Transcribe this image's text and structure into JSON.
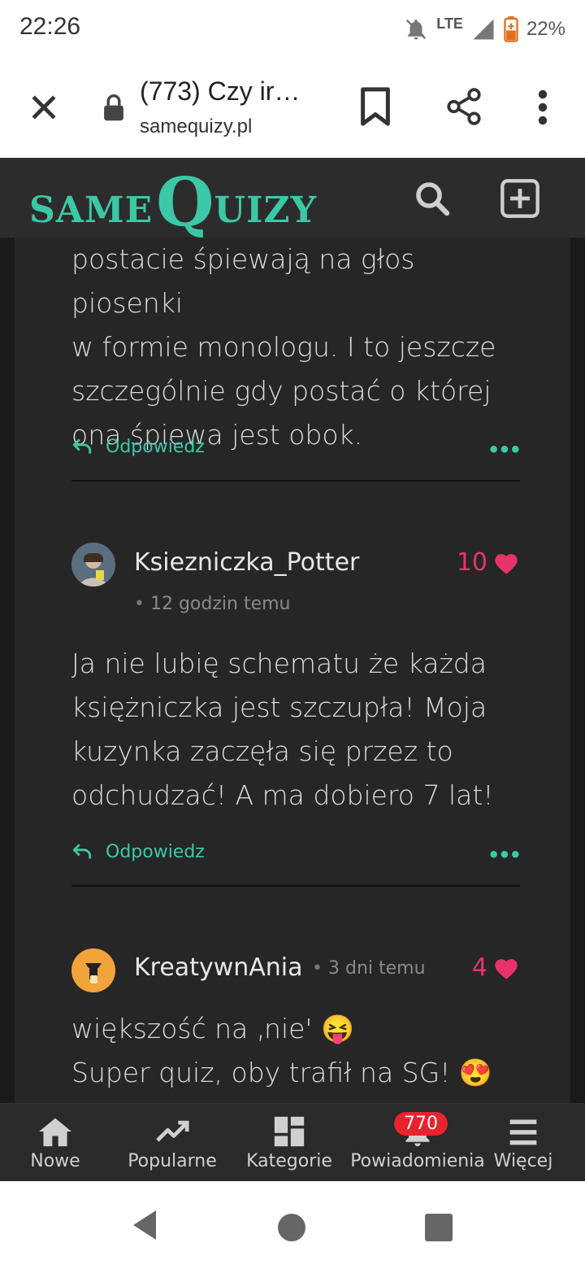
{
  "status_bar": {
    "time": "22:26",
    "network": "LTE",
    "battery_percent": "22%"
  },
  "browser": {
    "title": "(773) Czy ir…",
    "domain": "samequizy.pl"
  },
  "site": {
    "logo_same": "SAME",
    "logo_q": "Q",
    "logo_uizy": "UIZY",
    "accent_color": "#3cc8a6"
  },
  "comments": [
    {
      "text_lines": [
        "postacie śpiewają na głos piosenki",
        "w formie monologu. I to jeszcze",
        "szczególnie gdy postać o której",
        "ona śpiewa jest obok."
      ],
      "reply_label": "Odpowiedz",
      "more_label": "•••"
    },
    {
      "username": "Ksiezniczka_Potter",
      "likes": "10",
      "timestamp": "12 godzin temu",
      "text_lines": [
        "Ja nie lubię schematu że każda",
        "księżniczka jest szczupła! Moja",
        "kuzynka zaczęła się przez to",
        "odchudzać! A ma dobiero 7 lat!"
      ],
      "reply_label": "Odpowiedz",
      "more_label": "•••"
    },
    {
      "username": "KreatywnAnia",
      "likes": "4",
      "timestamp": "3 dni temu",
      "text_lines": [
        "większość na ‚nie' 😝",
        "Super quiz, oby trafił na SG! 😍"
      ]
    }
  ],
  "bottom_nav": {
    "items": [
      {
        "label": "Nowe",
        "icon": "home-icon"
      },
      {
        "label": "Popularne",
        "icon": "trending-icon"
      },
      {
        "label": "Kategorie",
        "icon": "dashboard-icon"
      },
      {
        "label": "Powiadomienia",
        "icon": "bell-icon",
        "badge": "770"
      },
      {
        "label": "Więcej",
        "icon": "menu-icon"
      }
    ]
  }
}
